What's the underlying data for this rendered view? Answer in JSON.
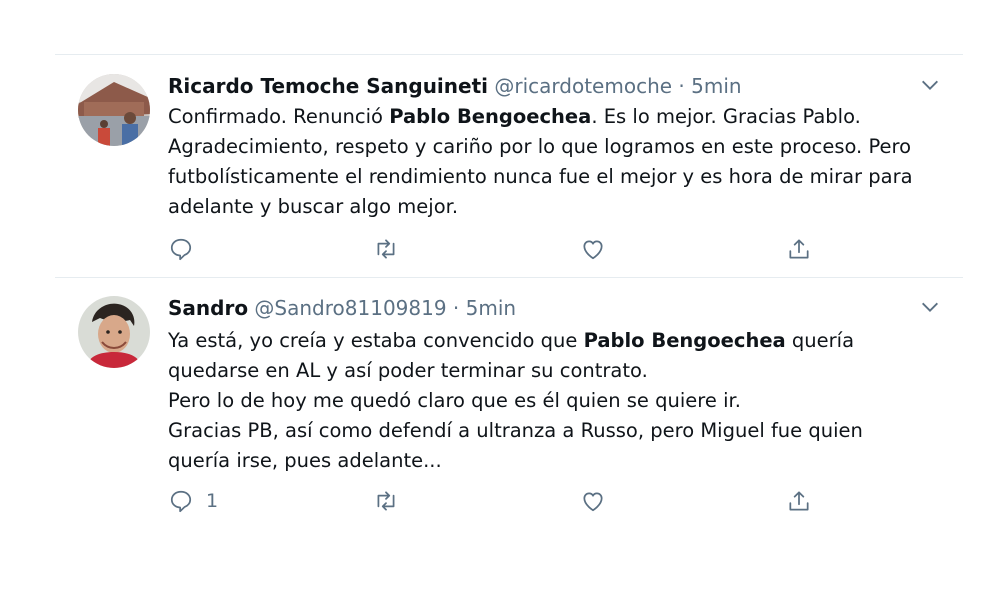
{
  "tweets": [
    {
      "name": "Ricardo Temoche Sanguineti",
      "handle": "@ricardotemoche",
      "sep": " · ",
      "time": "5min",
      "lines": [
        [
          "Confirmado. Renunció ",
          "Pablo Bengoechea",
          ". Es lo mejor. Gracias Pablo."
        ],
        [
          "Agradecimiento, respeto y cariño por lo que logramos en este proceso. Pero"
        ],
        [
          "futbolísticamente el rendimiento nunca fue el mejor y es hora de mirar para"
        ],
        [
          "adelante y buscar algo mejor."
        ]
      ],
      "reply_count": ""
    },
    {
      "name": "Sandro",
      "handle": "@Sandro81109819",
      "sep": " · ",
      "time": "5min",
      "lines": [
        [
          "Ya está, yo creía y estaba convencido que ",
          "Pablo Bengoechea",
          " quería"
        ],
        [
          "quedarse en AL y así poder  terminar su contrato."
        ],
        [
          "Pero lo de hoy me quedó claro que es él quien se quiere ir."
        ],
        [
          "Gracias PB, así como defendí a ultranza a Russo, pero Miguel fue quien"
        ],
        [
          "quería irse, pues adelante..."
        ]
      ],
      "reply_count": "1"
    }
  ],
  "icons": [
    "reply-icon",
    "retweet-icon",
    "like-icon",
    "share-icon",
    "chevron-down-icon"
  ],
  "colors": {
    "text": "#0f1419",
    "secondary": "#5b7083",
    "divider": "#e6ecf0"
  }
}
